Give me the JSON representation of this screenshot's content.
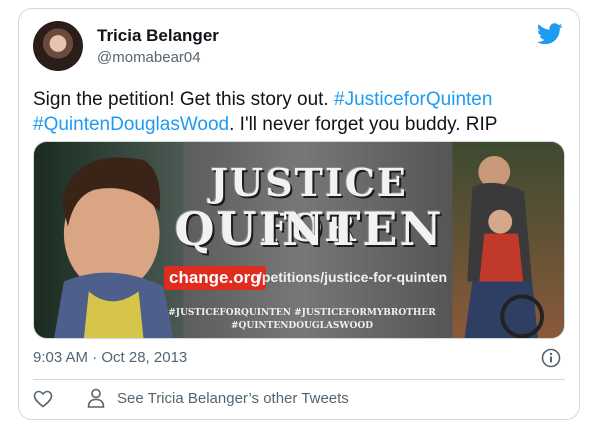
{
  "tweet": {
    "author_name": "Tricia Belanger",
    "author_handle": "@momabear04",
    "text_parts": {
      "part1": "Sign the petition! Get this story out. ",
      "hashtag1": "#JusticeforQuinten",
      "hashtag2": "#QuintenDouglasWood",
      "part2": ". I'll never forget you buddy. RIP"
    },
    "timestamp": "9:03 AM · Oct 28, 2013"
  },
  "media": {
    "title_line1": "JUSTICE FOR",
    "title_line2": "QUINTEN",
    "badge": "change.org",
    "url_path": "/petitions/justice-for-quinten",
    "hashtags_line1": "#JUSTICEFORQUINTEN   #JUSTICEFORMYBROTHER",
    "hashtags_line2": "#QUINTENDOUGLASWOOD"
  },
  "footer": {
    "other_tweets_label": "See Tricia Belanger’s other Tweets"
  },
  "icons": {
    "brand": "twitter-bird-icon",
    "info": "info-icon",
    "like": "heart-icon",
    "person": "person-icon"
  },
  "colors": {
    "link": "#1d9bf0",
    "muted": "#536471",
    "border": "#cfd9de",
    "badge": "#e02b1f"
  }
}
